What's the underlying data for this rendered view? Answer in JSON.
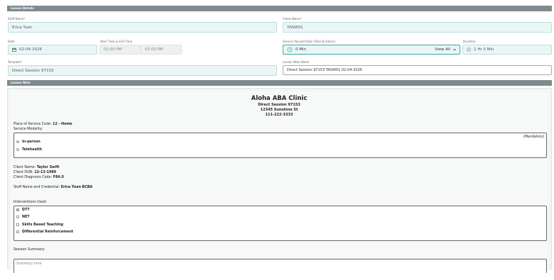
{
  "lesson_details": {
    "header": "Lesson Details",
    "staff_name": {
      "label": "Staff Name",
      "value": "Erica Yuen"
    },
    "client_name": {
      "label": "Client Name",
      "value": "TASW01"
    },
    "date": {
      "label": "Date",
      "value": "02-04-2026"
    },
    "time": {
      "label": "Start Time & End Time",
      "start": "02:00 PM",
      "end": "03:00 PM"
    },
    "session_paused": {
      "label": "Session Paused Date (Total Duration)",
      "value": "0 Min",
      "view_all": "View All"
    },
    "duration": {
      "label": "Duration",
      "value": "1 Hr 0 Min"
    },
    "template": {
      "label": "Template",
      "value": "Direct Session 97153"
    },
    "lesson_note_name": {
      "label": "Lesson Note Name",
      "value": "Direct Session 97153 TASW01  02-04-2026"
    },
    "required_mark": "*"
  },
  "lesson_note": {
    "header": "Lesson Note",
    "clinic_name": "Aloha ABA Clinic",
    "session_title": "Direct Session 97153",
    "address": "12345 Sunshine St",
    "phone": "111-222-3333",
    "place_of_service_label": "Place of Service Code: ",
    "place_of_service_value": "12 - Home",
    "service_modality_label": "Service Modality:",
    "mandatory": "(Mandatory)",
    "modality_options": [
      "In-person",
      "Telehealth"
    ],
    "client_name_label": "Client Name: ",
    "client_name_value": "Taylor Swift",
    "client_dob_label": "Client DOB: ",
    "client_dob_value": "12-13-1989",
    "diagnosis_label": "Client Diagnosis Code: ",
    "diagnosis_value": "F84.0",
    "staff_label": "Staff Name and Credential: ",
    "staff_value": "Erica Yuen BCBA",
    "interventions_label": "Interventions Used:",
    "interventions": [
      "DTT",
      "NET",
      "Skills Based Teaching",
      "Differential Reinforcement"
    ],
    "summary_label": "Session Summary:",
    "summary_placeholder": "Summary here"
  }
}
